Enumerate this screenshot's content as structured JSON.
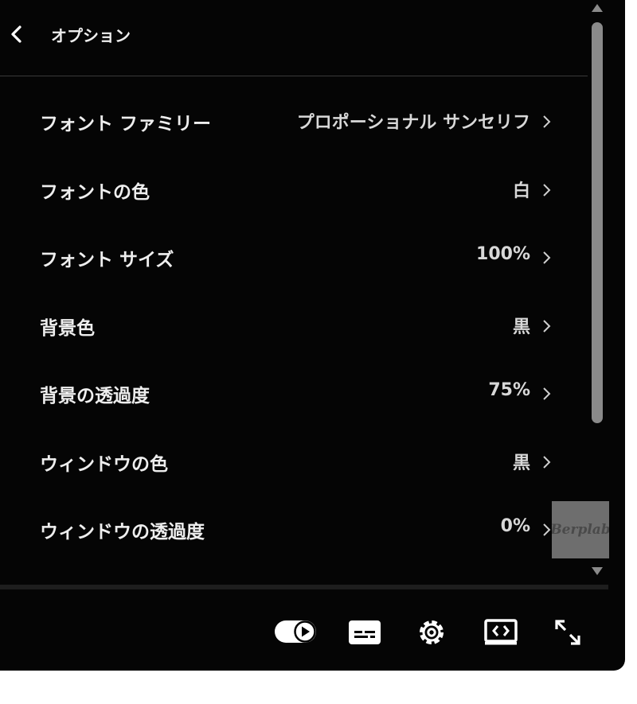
{
  "header": {
    "title": "オプション"
  },
  "menu": {
    "items": [
      {
        "label": "フォント ファミリー",
        "value": "プロポーショナル サンセリフ"
      },
      {
        "label": "フォントの色",
        "value": "白"
      },
      {
        "label": "フォント サイズ",
        "value": "100%"
      },
      {
        "label": "背景色",
        "value": "黒"
      },
      {
        "label": "背景の透過度",
        "value": "75%"
      },
      {
        "label": "ウィンドウの色",
        "value": "黒"
      },
      {
        "label": "ウィンドウの透過度",
        "value": "0%"
      }
    ]
  },
  "watermark": {
    "text": "Berplab"
  },
  "controls": {
    "icons": [
      "autoplay-toggle-icon",
      "subtitles-icon",
      "settings-gear-icon",
      "miniplayer-icon",
      "fullscreen-icon"
    ]
  },
  "colors": {
    "panel_bg": "#050505",
    "text": "#eeeeee",
    "scrollbar": "#8a8a8a"
  }
}
